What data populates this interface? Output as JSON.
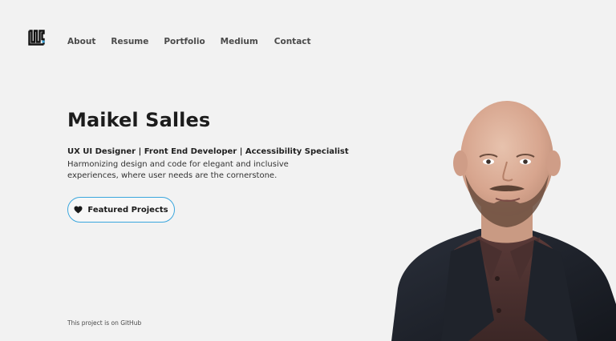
{
  "header": {
    "logo_icon": "monogram-logo-icon",
    "nav": [
      {
        "label": "About"
      },
      {
        "label": "Resume"
      },
      {
        "label": "Portfolio"
      },
      {
        "label": "Medium"
      },
      {
        "label": "Contact"
      }
    ]
  },
  "hero": {
    "name": "Maikel Salles",
    "roles": "UX UI Designer | Front End Developer | Accessibility Specialist",
    "description": "Harmonizing design and code for elegant and inclusive experiences, where user needs are the cornerstone.",
    "cta": {
      "label": "Featured Projects",
      "icon": "heart-icon"
    }
  },
  "footer": {
    "note": "This project is on GitHub"
  },
  "colors": {
    "background": "#f2f2f2",
    "accent": "#3aa6dd",
    "text": "#1a1a1a"
  }
}
